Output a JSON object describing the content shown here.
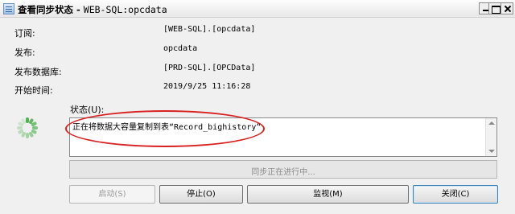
{
  "window": {
    "title_prefix": "查看同步状态 - ",
    "title_name": "WEB-SQL:opcdata"
  },
  "fields": [
    {
      "label": "订阅:",
      "value": "[WEB-SQL].[opcdata]"
    },
    {
      "label": "发布:",
      "value": "opcdata"
    },
    {
      "label": "发布数据库:",
      "value": "[PRD-SQL].[OPCData]"
    },
    {
      "label": "开始时间:",
      "value": "2019/9/25 11:16:28"
    }
  ],
  "status": {
    "label": "状态(U):",
    "message_prefix": "正在将数据大容量复制到表",
    "message_table": "“Record_bighistory”"
  },
  "progress": {
    "text": "同步正在进行中..."
  },
  "buttons": {
    "start": "启动(S)",
    "stop": "停止(O)",
    "monitor": "监视(M)",
    "close": "关闭(C)"
  },
  "icons": {
    "window": "window-icon",
    "spinner": "progress-spinner-icon",
    "spinner_color": "#53b153",
    "annotation_color": "#d82020"
  }
}
